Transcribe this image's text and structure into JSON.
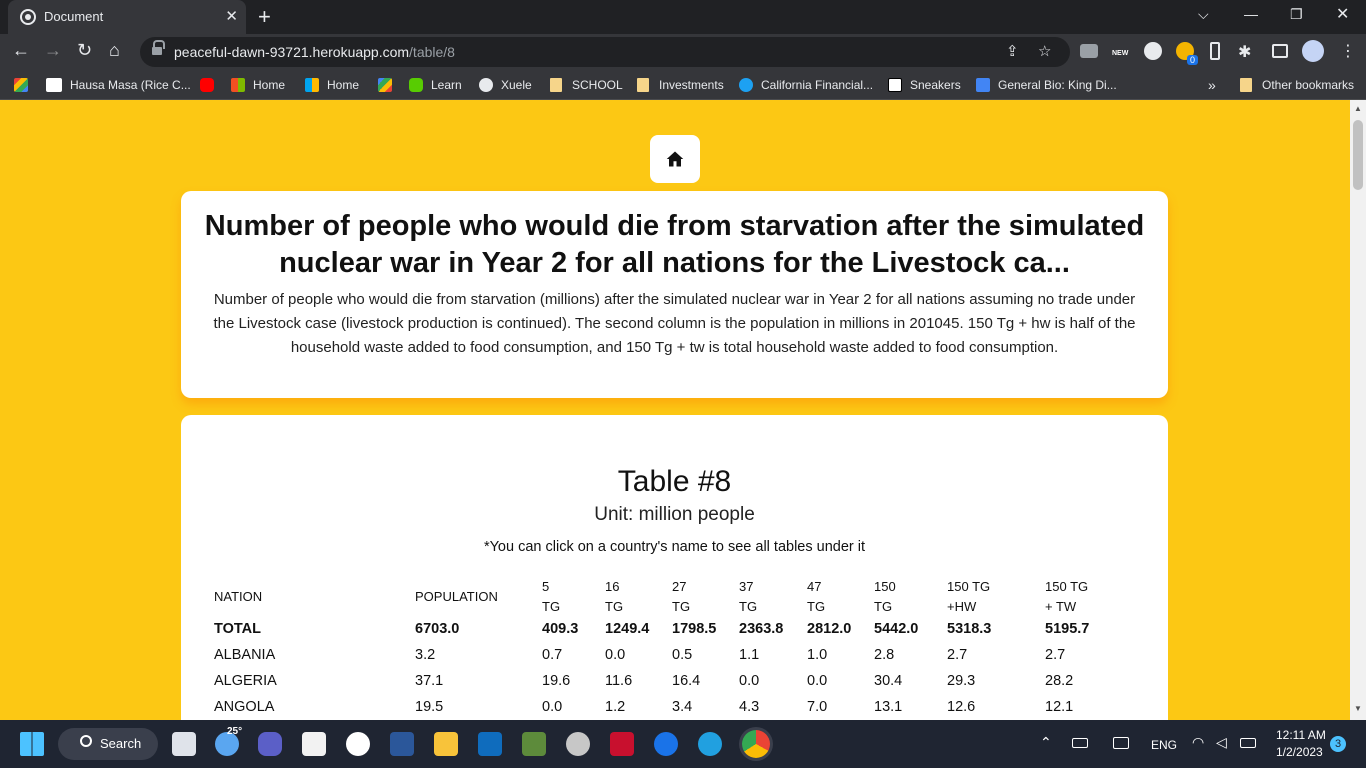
{
  "browser": {
    "tab_title": "Document",
    "url_host": "peaceful-dawn-93721.herokuapp.com",
    "url_path": "/table/8",
    "bookmarks": [
      "Hausa Masa (Rice C...",
      "Home",
      "Home",
      "Learn",
      "Xuele",
      "SCHOOL",
      "Investments",
      "California Financial...",
      "Sneakers",
      "General Bio: King Di..."
    ],
    "other_bookmarks": "Other bookmarks",
    "more_bookmarks": "»",
    "ext_badge": "NEW",
    "ext_count": "0"
  },
  "page": {
    "title": "Number of people who would die from starvation after the simulated nuclear war in Year 2 for all nations for the Livestock ca...",
    "description": "Number of people who would die from starvation (millions) after the simulated nuclear war in Year 2 for all nations assuming no trade under the Livestock case (livestock production is continued). The second column is the population in millions in 201045. 150 Tg + hw is half of the household waste added to food consumption, and 150 Tg + tw is total household waste added to food consumption.",
    "table_title": "Table #8",
    "unit": "Unit: million people",
    "note": "*You can click on a country's name to see all tables under it"
  },
  "table": {
    "headers": [
      [
        "NATION",
        ""
      ],
      [
        "POPULATION",
        ""
      ],
      [
        "5",
        "TG"
      ],
      [
        "16",
        "TG"
      ],
      [
        "27",
        "TG"
      ],
      [
        "37",
        "TG"
      ],
      [
        "47",
        "TG"
      ],
      [
        "150",
        "TG"
      ],
      [
        "150 TG",
        "+HW"
      ],
      [
        "150 TG",
        "+ TW"
      ]
    ],
    "rows": [
      [
        "TOTAL",
        "6703.0",
        "409.3",
        "1249.4",
        "1798.5",
        "2363.8",
        "2812.0",
        "5442.0",
        "5318.3",
        "5195.7"
      ],
      [
        "ALBANIA",
        "3.2",
        "0.7",
        "0.0",
        "0.5",
        "1.1",
        "1.0",
        "2.8",
        "2.7",
        "2.7"
      ],
      [
        "ALGERIA",
        "37.1",
        "19.6",
        "11.6",
        "16.4",
        "0.0",
        "0.0",
        "30.4",
        "29.3",
        "28.2"
      ],
      [
        "ANGOLA",
        "19.5",
        "0.0",
        "1.2",
        "3.4",
        "4.3",
        "7.0",
        "13.1",
        "12.6",
        "12.1"
      ]
    ]
  },
  "taskbar": {
    "search_label": "Search",
    "weather_temp": "25°",
    "lang": "ENG",
    "time": "12:11 AM",
    "date": "1/2/2023",
    "notification_count": "3"
  }
}
